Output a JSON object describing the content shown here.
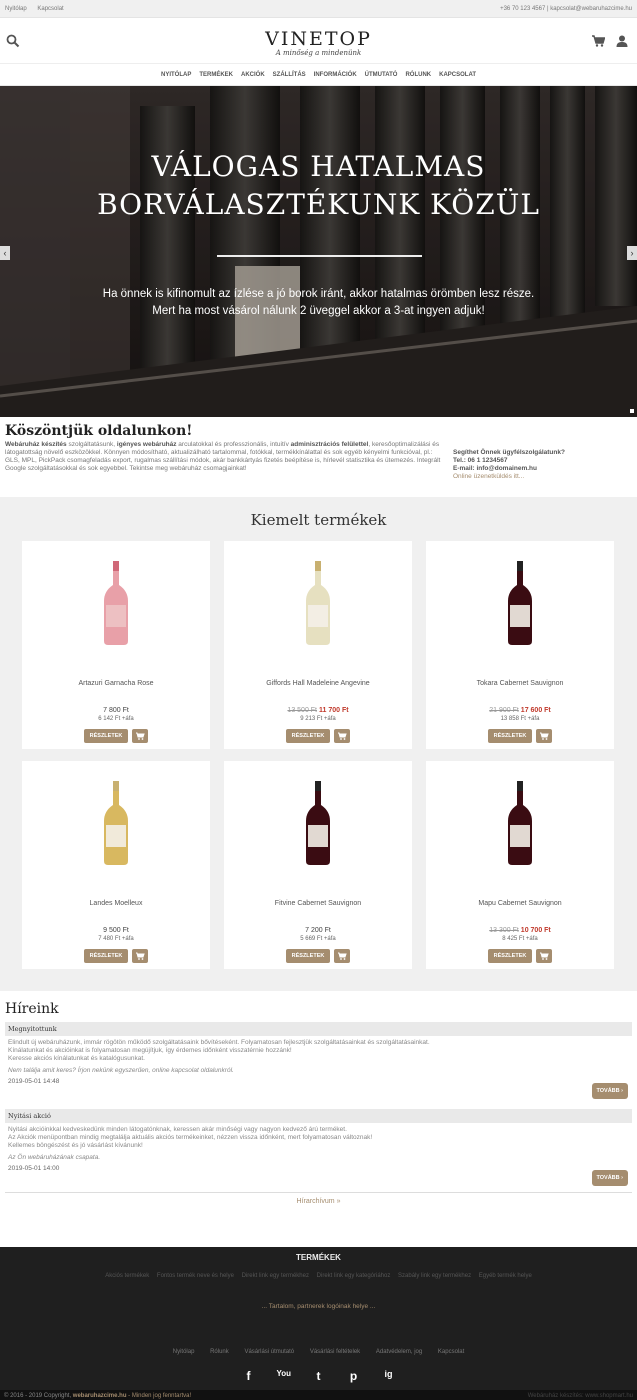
{
  "topbar": {
    "links": [
      "Nyitólap",
      "Kapcsolat"
    ],
    "contact": "+36 70 123 4567 | kapcsolat@webaruhazcime.hu"
  },
  "header": {
    "logo": "VINETOP",
    "tagline": "A minőség a mindenünk",
    "colors": {
      "accent": "#a58d6f"
    }
  },
  "nav": [
    "NYITÓLAP",
    "TERMÉKEK",
    "AKCIÓK",
    "SZÁLLÍTÁS",
    "INFORMÁCIÓK",
    "ÚTMUTATÓ",
    "RÓLUNK",
    "KAPCSOLAT"
  ],
  "hero": {
    "title_line1": "VÁLOGAS HATALMAS",
    "title_line2": "BORVÁLASZTÉKUNK KÖZÜL",
    "text_line1": "Ha önnek is kifinomult az ízlése a jó borok iránt, akkor hatalmas örömben lesz része.",
    "text_line2": "Mert ha most vásárol nálunk 2 üveggel akkor a 3-at ingyen adjuk!"
  },
  "welcome": {
    "title": "Köszöntjük oldalunkon!",
    "text_bold1": "Webáruház készítés",
    "text1": " szolgáltatásunk, ",
    "text_bold2": "igényes webáruház",
    "text2": " arculatokkal és professzionális, intuitív ",
    "text_bold3": "adminisztrációs felülettel",
    "text3": ", keresőoptimalizálási és látogatottság növelő eszközökkel. Könnyen módosítható, aktualizálható tartalommal, fotókkal, termékkínálattal és sok egyéb kényelmi funkcióval, pl.: GLS, MPL, PickPack csomagfeladás export, rugalmas szállítási módok, akár bankkártyás fizetés beépítése is, hírlevél statisztika és ütemezés. Integrált Google szolgáltatásokkal és sok egyebbel. Tekintse meg webáruház csomagjainkat!",
    "help_title": "Segíthet Önnek ügyfélszolgálatunk?",
    "tel": "Tel.: 06 1 1234567",
    "email": "E-mail: info@domainem.hu",
    "online": "Online üzenetküldés itt..."
  },
  "featured": {
    "title": "Kiemelt termékek",
    "details_label": "RÉSZLETEK",
    "products": [
      {
        "name": "Artazuri Garnacha Rose",
        "old_price": "",
        "price": "7 800 Ft",
        "net": "6 142 Ft +áfa",
        "wine": "rose"
      },
      {
        "name": "Giffords Hall Madeleine Angevine",
        "old_price": "13 500 Ft",
        "price": "11 700 Ft",
        "net": "9 213 Ft +áfa",
        "wine": "white"
      },
      {
        "name": "Tokara Cabernet Sauvignon",
        "old_price": "21 900 Ft",
        "price": "17 600 Ft",
        "net": "13 858 Ft +áfa",
        "wine": "red"
      },
      {
        "name": "Landes Moelleux",
        "old_price": "",
        "price": "9 500 Ft",
        "net": "7 480 Ft +áfa",
        "wine": "gold"
      },
      {
        "name": "Fitvine Cabernet Sauvignon",
        "old_price": "",
        "price": "7 200 Ft",
        "net": "5 669 Ft +áfa",
        "wine": "red"
      },
      {
        "name": "Mapu Cabernet Sauvignon",
        "old_price": "13 300 Ft",
        "price": "10 700 Ft",
        "net": "8 425 Ft +áfa",
        "wine": "red"
      }
    ]
  },
  "news": {
    "title": "Híreink",
    "more_label": "TOVÁBB",
    "items": [
      {
        "title": "Megnyitottunk",
        "lines": [
          "Elindult új webáruházunk, immár rögötön működő szolgáltatásaink bővítéseként. Folyamatosan fejlesztjük szolgáltatásainkat és szolgáltatásainkat.",
          "Kínálatunkat és akcióinkat is folyamatosan megújítjuk, így érdemes időnként visszatérnie hozzánk!",
          "Keresse akciós kínálatunkat és katalógusunkat."
        ],
        "italic": "Nem találja amit keres? Írjon nekünk egyszerűen, online kapcsolat oldalunkról.",
        "date": "2019-05-01 14:48"
      },
      {
        "title": "Nyitási akció",
        "lines": [
          "Nyitási akcióinkkal kedveskedünk minden látogatónknak, keressen akár minőségi vagy nagyon kedvező árú terméket.",
          "Az Akciók menüpontban mindig megtalálja aktuális akciós termékeinket, nézzen vissza időnként, mert folyamatosan változnak!",
          "Kellemes böngészést és jó vásárlást kívánunk!"
        ],
        "italic": "Az Ön webáruházának csapata.",
        "date": "2019-05-01 14:00"
      }
    ],
    "archive": "Hírarchívum »"
  },
  "footer": {
    "title": "TERMÉKEK",
    "links": [
      "Akciós termékek",
      "Fontos termék neve és helye",
      "Direkt link egy termékhez",
      "Direkt link egy kategóriához",
      "Szabály link egy termékhez",
      "Egyéb termék helye"
    ],
    "partners": "... Tartalom, partnerek logóinak helye ...",
    "menu": [
      "Nyitólap",
      "Rólunk",
      "Vásárlási útmutató",
      "Vásárlási feltételek",
      "Adatvédelem, jog",
      "Kapcsolat"
    ],
    "social": [
      "f",
      "You",
      "t",
      "p",
      "ig"
    ],
    "copyright_pre": "© 2016 - 2019 Copyright, ",
    "copyright_site": "webaruhazcime.hu",
    "copyright_post": " - Minden jog fenntartva!",
    "credit": "Webáruház készítés: www.shopmart.hu"
  }
}
